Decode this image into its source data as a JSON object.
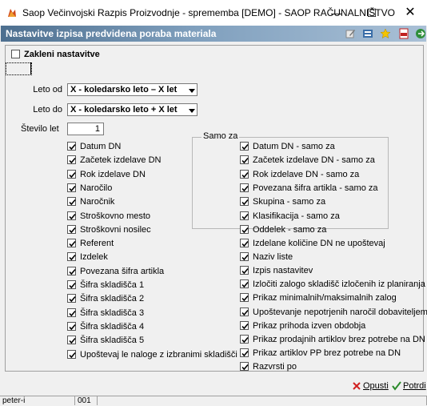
{
  "window": {
    "title": "Saop  Večinvojski Razpis Proizvodnje - sprememba [DEMO] - SAOP RAČUNALNIŠTVO",
    "minimize": "—",
    "maximize": "☐",
    "close": "✕"
  },
  "header": {
    "title": "Nastavitve izpisa predvidena poraba materiala"
  },
  "lock": {
    "label": "Zakleni nastavitve",
    "checked": false
  },
  "fields": {
    "leto_od": {
      "label": "Leto od",
      "value": "X - koledarsko leto – X let"
    },
    "leto_do": {
      "label": "Leto do",
      "value": "X - koledarsko leto + X let"
    },
    "stevilo_let": {
      "label": "Število let",
      "value": "1"
    }
  },
  "left_options": [
    {
      "label": "Datum DN",
      "checked": true
    },
    {
      "label": "Začetek izdelave DN",
      "checked": true
    },
    {
      "label": "Rok izdelave DN",
      "checked": true
    },
    {
      "label": "Naročilo",
      "checked": true
    },
    {
      "label": "Naročnik",
      "checked": true
    },
    {
      "label": "Stroškovno mesto",
      "checked": true
    },
    {
      "label": "Stroškovni nosilec",
      "checked": true
    },
    {
      "label": "Referent",
      "checked": true
    },
    {
      "label": "Izdelek",
      "checked": true
    },
    {
      "label": "Povezana šifra artikla",
      "checked": true
    },
    {
      "label": "Šifra skladišča 1",
      "checked": true
    },
    {
      "label": "Šifra skladišča 2",
      "checked": true
    },
    {
      "label": "Šifra skladišča 3",
      "checked": true
    },
    {
      "label": "Šifra skladišča 4",
      "checked": true
    },
    {
      "label": "Šifra skladišča 5",
      "checked": true
    },
    {
      "label": "Upoštevaj le naloge z izbranimi skladišči",
      "checked": true
    }
  ],
  "samo_za": {
    "title": "Samo za",
    "options": [
      {
        "label": "Datum DN - samo za",
        "checked": true
      },
      {
        "label": "Začetek izdelave DN - samo za",
        "checked": true
      },
      {
        "label": "Rok izdelave DN - samo za",
        "checked": true
      },
      {
        "label": "Povezana šifra artikla - samo za",
        "checked": true
      },
      {
        "label": "Skupina - samo za",
        "checked": true
      },
      {
        "label": "Klasifikacija - samo za",
        "checked": true
      },
      {
        "label": "Oddelek - samo za",
        "checked": true
      }
    ]
  },
  "right_options": [
    {
      "label": "Izdelane količine DN ne upoštevaj",
      "checked": true
    },
    {
      "label": "Naziv liste",
      "checked": true
    },
    {
      "label": "Izpis nastavitev",
      "checked": true
    },
    {
      "label": "Izločiti zalogo skladišč izločenih iz planiranja",
      "checked": true
    },
    {
      "label": "Prikaz minimalnih/maksimalnih zalog",
      "checked": true
    },
    {
      "label": "Upoštevanje nepotrjenih naročil dobaviteljem",
      "checked": true
    },
    {
      "label": "Prikaz prihoda izven obdobja",
      "checked": true
    },
    {
      "label": "Prikaz prodajnih artiklov brez potrebe na DN",
      "checked": true
    },
    {
      "label": "Prikaz artiklov PP brez potrebe na DN",
      "checked": true
    },
    {
      "label": "Razvrsti po",
      "checked": true
    }
  ],
  "buttons": {
    "cancel": "Opusti",
    "confirm": "Potrdi"
  },
  "status": {
    "user": "peter-i",
    "code": "001"
  },
  "colors": {
    "header_bg": "#5f82a3",
    "cancel_icon": "#d02020",
    "confirm_icon": "#2a8a2a"
  }
}
